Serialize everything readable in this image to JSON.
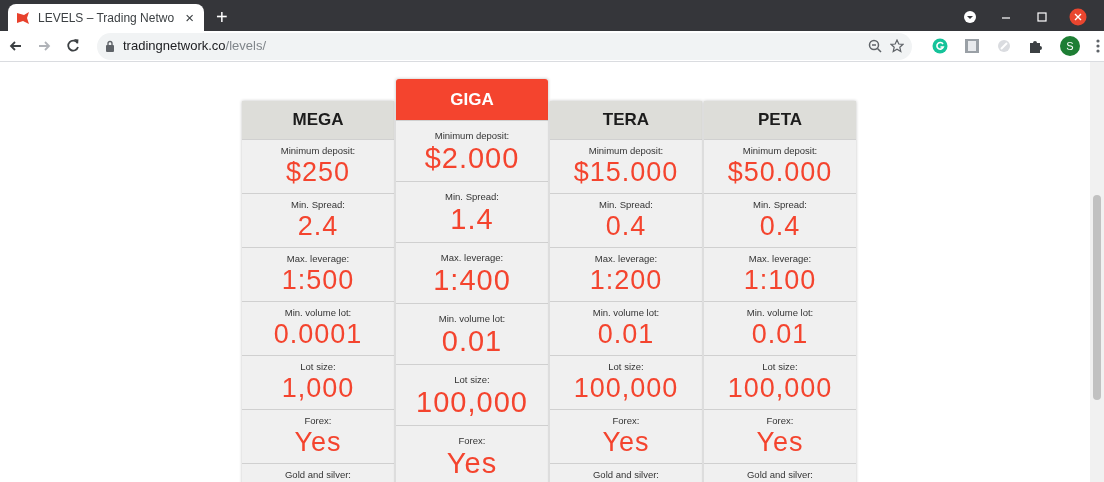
{
  "tab": {
    "title": "LEVELS – Trading Netwo",
    "close": "×"
  },
  "new_tab": "+",
  "nav_buttons": [
    {
      "kind": "back",
      "disabled": false
    },
    {
      "kind": "forward",
      "disabled": true
    },
    {
      "kind": "reload",
      "disabled": false
    }
  ],
  "address": {
    "host": "tradingnetwork.co",
    "path": "/levels/"
  },
  "profile": {
    "initial": "S"
  },
  "plans": [
    {
      "name": "MEGA",
      "highlighted": false,
      "rows": [
        {
          "label": "Minimum deposit:",
          "value": "$250"
        },
        {
          "label": "Min. Spread:",
          "value": "2.4"
        },
        {
          "label": "Max. leverage:",
          "value": "1:500"
        },
        {
          "label": "Min. volume lot:",
          "value": "0.0001"
        },
        {
          "label": "Lot size:",
          "value": "1,000"
        },
        {
          "label": "Forex:",
          "value": "Yes"
        },
        {
          "label": "Gold and silver:"
        }
      ]
    },
    {
      "name": "GIGA",
      "highlighted": true,
      "rows": [
        {
          "label": "Minimum deposit:",
          "value": "$2.000"
        },
        {
          "label": "Min. Spread:",
          "value": "1.4"
        },
        {
          "label": "Max. leverage:",
          "value": "1:400"
        },
        {
          "label": "Min. volume lot:",
          "value": "0.01"
        },
        {
          "label": "Lot size:",
          "value": "100,000"
        },
        {
          "label": "Forex:",
          "value": "Yes"
        }
      ]
    },
    {
      "name": "TERA",
      "highlighted": false,
      "rows": [
        {
          "label": "Minimum deposit:",
          "value": "$15.000"
        },
        {
          "label": "Min. Spread:",
          "value": "0.4"
        },
        {
          "label": "Max. leverage:",
          "value": "1:200"
        },
        {
          "label": "Min. volume lot:",
          "value": "0.01"
        },
        {
          "label": "Lot size:",
          "value": "100,000"
        },
        {
          "label": "Forex:",
          "value": "Yes"
        },
        {
          "label": "Gold and silver:"
        }
      ]
    },
    {
      "name": "PETA",
      "highlighted": false,
      "rows": [
        {
          "label": "Minimum deposit:",
          "value": "$50.000"
        },
        {
          "label": "Min. Spread:",
          "value": "0.4"
        },
        {
          "label": "Max. leverage:",
          "value": "1:100"
        },
        {
          "label": "Min. volume lot:",
          "value": "0.01"
        },
        {
          "label": "Lot size:",
          "value": "100,000"
        },
        {
          "label": "Forex:",
          "value": "Yes"
        },
        {
          "label": "Gold and silver:"
        }
      ]
    }
  ]
}
